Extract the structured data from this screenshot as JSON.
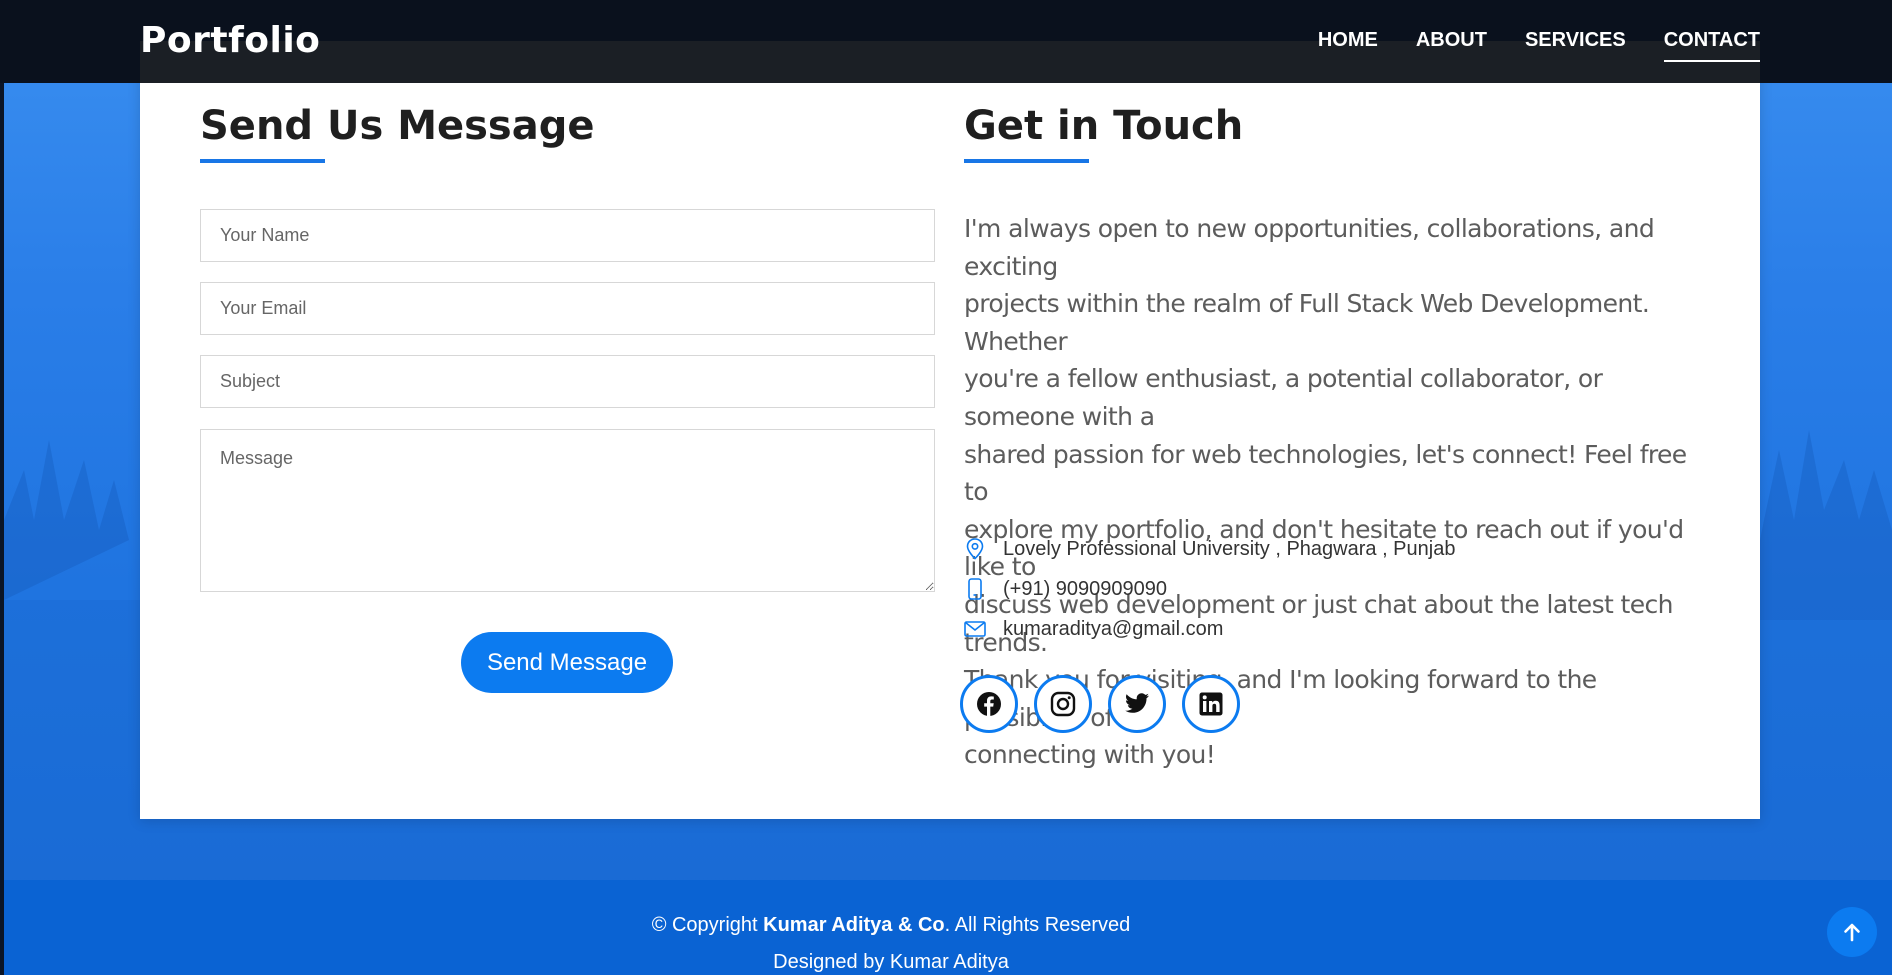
{
  "navbar": {
    "brand": "Portfolio",
    "links": [
      {
        "label": "HOME",
        "active": false
      },
      {
        "label": "ABOUT",
        "active": false
      },
      {
        "label": "SERVICES",
        "active": false
      },
      {
        "label": "CONTACT",
        "active": true
      }
    ]
  },
  "contact_form": {
    "title": "Send Us Message",
    "name_placeholder": "Your Name",
    "email_placeholder": "Your Email",
    "subject_placeholder": "Subject",
    "message_placeholder": "Message",
    "submit_label": "Send Message"
  },
  "get_in_touch": {
    "title": "Get in Touch",
    "paragraph_lines": [
      "I'm always open to new opportunities, collaborations, and exciting",
      "projects within the realm of Full Stack Web Development. Whether",
      "you're a fellow enthusiast, a potential collaborator, or someone with a",
      "shared passion for web technologies, let's connect! Feel free to",
      "explore my portfolio, and don't hesitate to reach out if you'd like to",
      "discuss web development or just chat about the latest tech trends.",
      "Thank you for visiting, and I'm looking forward to the possibility of",
      "connecting with you!"
    ],
    "address": "Lovely Professional University , Phagwara , Punjab",
    "phone": "(+91) 9090909090",
    "email": "kumaraditya@gmail.com",
    "icons": {
      "address": "location-pin-icon",
      "phone": "phone-icon",
      "email": "envelope-icon"
    },
    "socials": [
      "facebook-icon",
      "instagram-icon",
      "twitter-icon",
      "linkedin-icon"
    ]
  },
  "footer": {
    "copyright_prefix": "© Copyright ",
    "company": "Kumar Aditya & Co",
    "copyright_suffix": ". All Rights Reserved",
    "designed_by": "Designed by Kumar Aditya"
  },
  "back_to_top_icon": "arrow-up-icon",
  "colors": {
    "accent": "#0c7bf0",
    "navbar": "#0a111d",
    "background": "#2a7ee8",
    "footer": "#0a63d3"
  }
}
